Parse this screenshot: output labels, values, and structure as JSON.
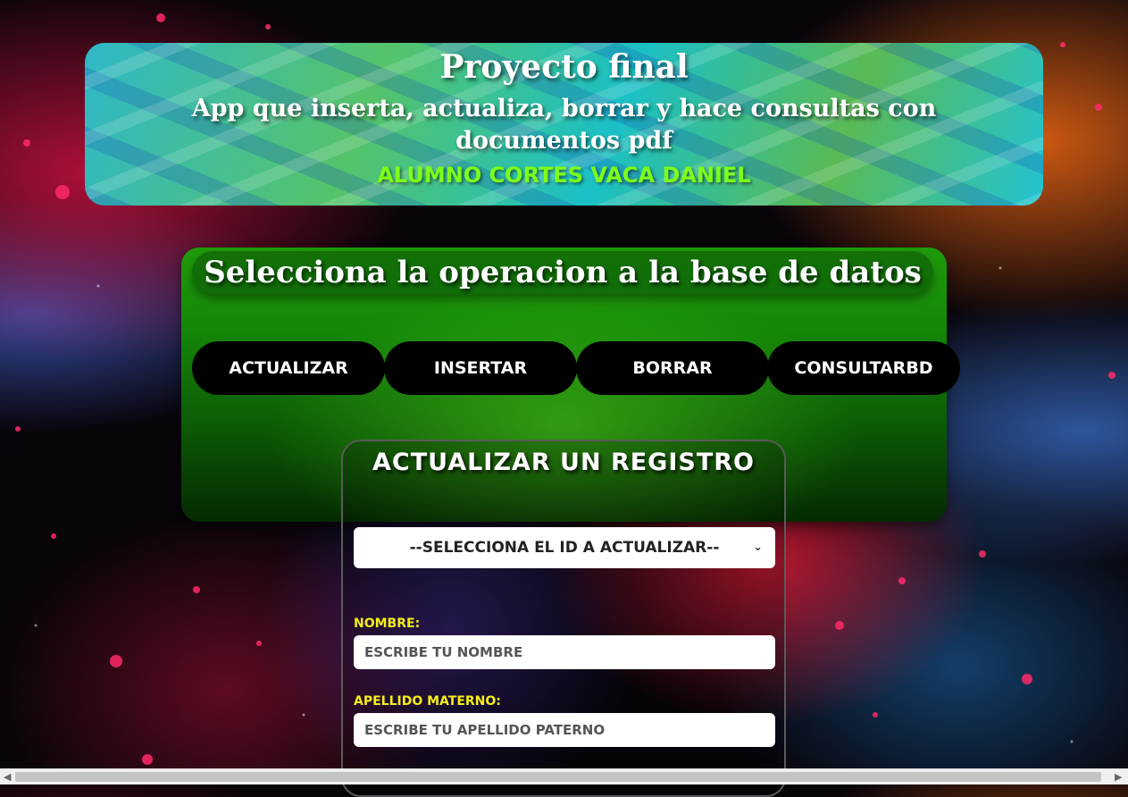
{
  "header": {
    "title": "Proyecto final",
    "subtitle": "App que inserta, actualiza, borrar y hace consultas con documentos pdf",
    "author": "ALUMNO CORTES VACA DANIEL"
  },
  "operations": {
    "title": "Selecciona la operacion a la base de datos",
    "buttons": [
      "ACTUALIZAR",
      "INSERTAR",
      "BORRAR",
      "CONSULTARBD"
    ]
  },
  "form": {
    "title": "ACTUALIZAR UN REGISTRO",
    "select_label": "--SELECCIONA EL ID A ACTUALIZAR--",
    "nombre_label": "NOMBRE:",
    "nombre_placeholder": "ESCRIBE TU NOMBRE",
    "apellido_label": "APELLIDO MATERNO:",
    "apellido_placeholder": "ESCRIBE TU APELLIDO PATERNO"
  },
  "colors": {
    "author": "#7cff1a",
    "labels": "#f5ee1a",
    "panel_green": "#158708"
  }
}
